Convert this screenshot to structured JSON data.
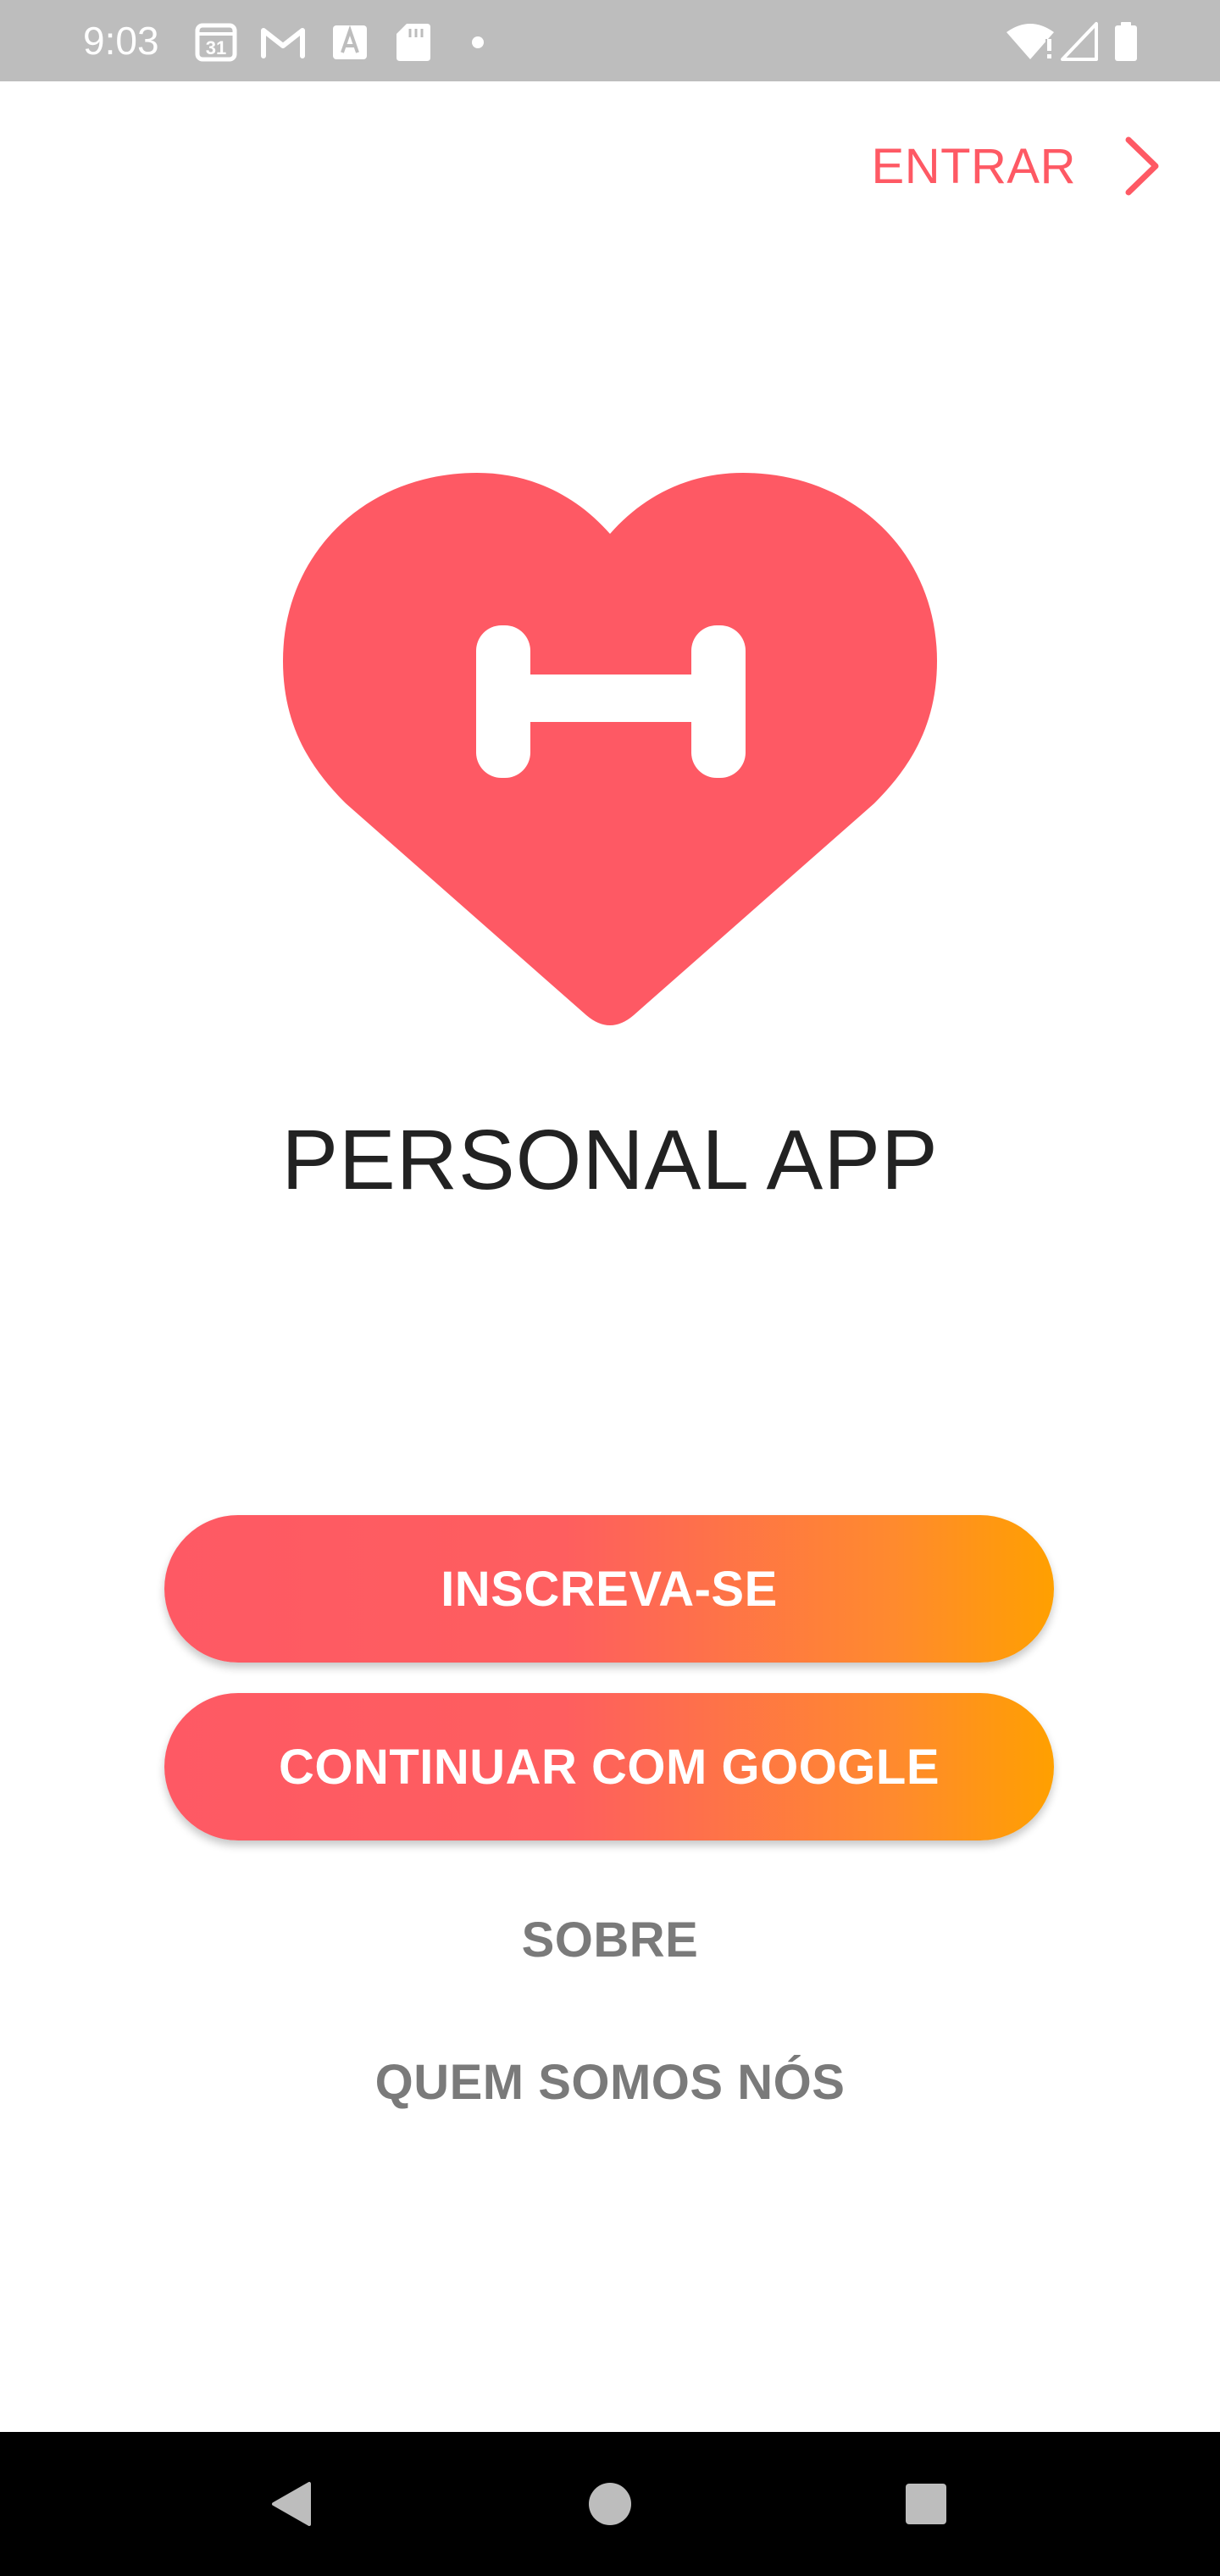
{
  "status_bar": {
    "time": "9:03",
    "calendar_day": "31",
    "icons": [
      "calendar-icon",
      "gmail-icon",
      "font-a-icon",
      "sd-card-icon",
      "notification-dot-icon",
      "wifi-alert-icon",
      "cell-signal-icon",
      "battery-icon"
    ],
    "text_color": "#ffffff",
    "background": "#bdbdbd"
  },
  "header": {
    "enter_label": "ENTRAR",
    "enter_icon": "chevron-right-icon"
  },
  "logo": {
    "icon": "heart-dumbbell-icon",
    "color": "#fe5964"
  },
  "app": {
    "title": "PERSONAL APP"
  },
  "actions": {
    "signup_label": "INSCREVA-SE",
    "google_label": "CONTINUAR COM GOOGLE",
    "gradient_start": "#fe5964",
    "gradient_end": "#ffa000"
  },
  "links": {
    "about_label": "SOBRE",
    "who_label": "QUEM SOMOS NÓS"
  },
  "nav_bar": {
    "icons": [
      "back-icon",
      "home-icon",
      "recents-icon"
    ]
  }
}
